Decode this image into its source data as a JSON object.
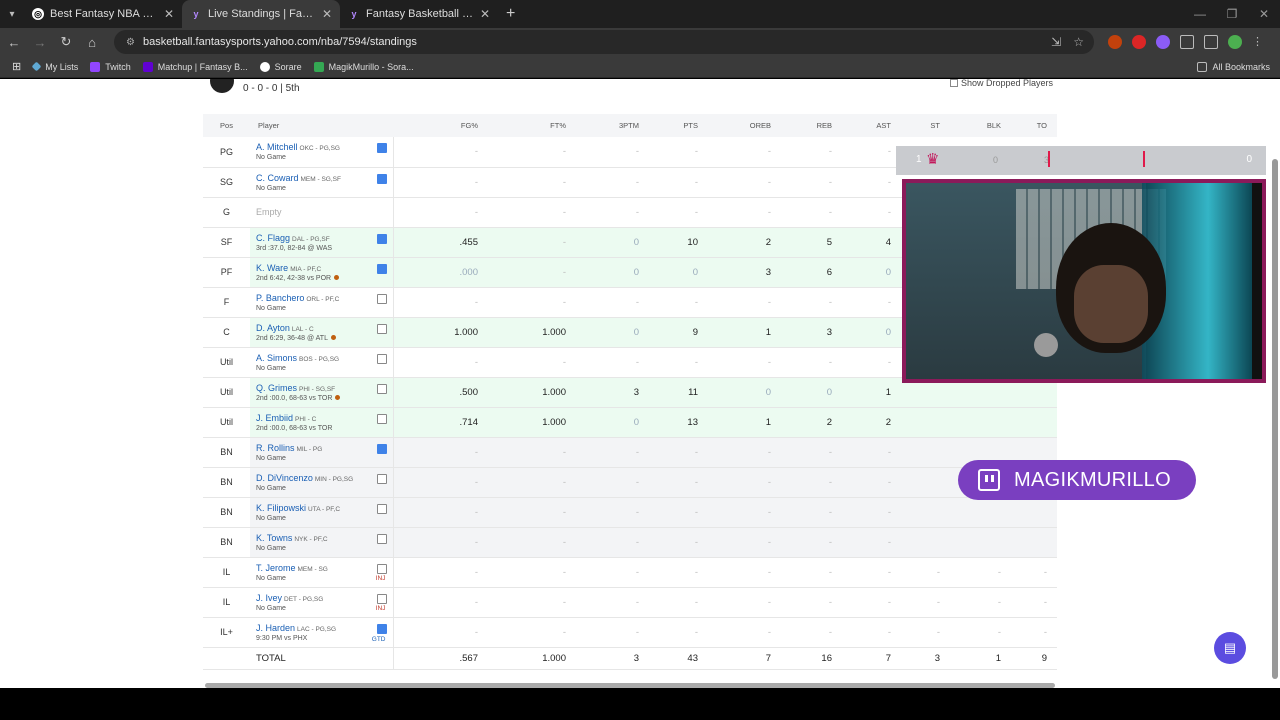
{
  "browser": {
    "tabs": [
      {
        "title": "Best Fantasy NBA – Sorare NBA",
        "active": false
      },
      {
        "title": "Live Standings | Fantasy Basketb",
        "active": true
      },
      {
        "title": "Fantasy Basketball | Yahoo! Spo",
        "active": false
      }
    ],
    "url": "basketball.fantasysports.yahoo.com/nba/7594/standings",
    "bookmarks": [
      "My Lists",
      "Twitch",
      "Matchup | Fantasy B...",
      "Sorare",
      "MagikMurillo - Sora..."
    ],
    "all_bookmarks": "All Bookmarks"
  },
  "team": {
    "record": "0 - 0 - 0 | 5th"
  },
  "show_dropped_label": "Show Dropped Players",
  "columns": [
    "Pos",
    "Player",
    "FG%",
    "FT%",
    "3PTM",
    "PTS",
    "OREB",
    "REB",
    "AST",
    "ST",
    "BLK",
    "TO"
  ],
  "rows": [
    {
      "pos": "PG",
      "name": "A. Mitchell",
      "team": "OKC - PG,SG",
      "status": "No Game",
      "note": "blue",
      "tag": "",
      "type": "normal",
      "stats": [
        "-",
        "-",
        "-",
        "-",
        "-",
        "-",
        "-",
        "-",
        "-",
        "-"
      ]
    },
    {
      "pos": "SG",
      "name": "C. Coward",
      "team": "MEM - SG,SF",
      "status": "No Game",
      "note": "blue",
      "tag": "",
      "type": "normal",
      "stats": [
        "-",
        "-",
        "-",
        "-",
        "-",
        "-",
        "-",
        "-",
        "-",
        "-"
      ]
    },
    {
      "pos": "G",
      "name": "Empty",
      "team": "",
      "status": "",
      "note": "",
      "tag": "",
      "type": "empty",
      "stats": [
        "-",
        "-",
        "-",
        "-",
        "-",
        "-",
        "-",
        "-",
        "-",
        "-"
      ]
    },
    {
      "pos": "SF",
      "name": "C. Flagg",
      "team": "DAL - PG,SF",
      "status": "3rd :37.0, 82-84 @ WAS",
      "note": "blue",
      "tag": "",
      "type": "played",
      "stats": [
        ".455",
        "-",
        "0",
        "10",
        "2",
        "5",
        "4",
        "",
        "",
        ""
      ]
    },
    {
      "pos": "PF",
      "name": "K. Ware",
      "team": "MIA - PF,C",
      "status": "2nd 6:42, 42-38 vs POR",
      "note": "blue",
      "tag": "dot",
      "type": "played",
      "stats": [
        ".000",
        "-",
        "0",
        "0",
        "3",
        "6",
        "0",
        "",
        "",
        ""
      ]
    },
    {
      "pos": "F",
      "name": "P. Banchero",
      "team": "ORL - PF,C",
      "status": "No Game",
      "note": "grey",
      "tag": "",
      "type": "normal",
      "stats": [
        "-",
        "-",
        "-",
        "-",
        "-",
        "-",
        "-",
        "",
        "",
        ""
      ]
    },
    {
      "pos": "C",
      "name": "D. Ayton",
      "team": "LAL - C",
      "status": "2nd 6:29, 36-48 @ ATL",
      "note": "grey",
      "tag": "dot",
      "type": "played",
      "stats": [
        "1.000",
        "1.000",
        "0",
        "9",
        "1",
        "3",
        "0",
        "",
        "",
        ""
      ]
    },
    {
      "pos": "Util",
      "name": "A. Simons",
      "team": "BOS - PG,SG",
      "status": "No Game",
      "note": "grey",
      "tag": "",
      "type": "normal",
      "stats": [
        "-",
        "-",
        "-",
        "-",
        "-",
        "-",
        "-",
        "",
        "",
        ""
      ]
    },
    {
      "pos": "Util",
      "name": "Q. Grimes",
      "team": "PHI - SG,SF",
      "status": "2nd :00.0, 68-63 vs TOR",
      "note": "grey",
      "tag": "dot",
      "type": "played",
      "stats": [
        ".500",
        "1.000",
        "3",
        "11",
        "0",
        "0",
        "1",
        "",
        "",
        ""
      ]
    },
    {
      "pos": "Util",
      "name": "J. Embiid",
      "team": "PHI - C",
      "status": "2nd :00.0, 68-63 vs TOR",
      "note": "grey",
      "tag": "",
      "type": "played",
      "stats": [
        ".714",
        "1.000",
        "0",
        "13",
        "1",
        "2",
        "2",
        "",
        "",
        ""
      ]
    },
    {
      "pos": "BN",
      "name": "R. Rollins",
      "team": "MIL - PG",
      "status": "No Game",
      "note": "blue",
      "tag": "",
      "type": "bench",
      "stats": [
        "-",
        "-",
        "-",
        "-",
        "-",
        "-",
        "-",
        "",
        "",
        ""
      ]
    },
    {
      "pos": "BN",
      "name": "D. DiVincenzo",
      "team": "MIN - PG,SG",
      "status": "No Game",
      "note": "grey",
      "tag": "",
      "type": "bench",
      "stats": [
        "-",
        "-",
        "-",
        "-",
        "-",
        "-",
        "-",
        "",
        "",
        ""
      ]
    },
    {
      "pos": "BN",
      "name": "K. Filipowski",
      "team": "UTA - PF,C",
      "status": "No Game",
      "note": "grey",
      "tag": "",
      "type": "bench",
      "stats": [
        "-",
        "-",
        "-",
        "-",
        "-",
        "-",
        "-",
        "",
        "",
        ""
      ]
    },
    {
      "pos": "BN",
      "name": "K. Towns",
      "team": "NYK - PF,C",
      "status": "No Game",
      "note": "grey",
      "tag": "",
      "type": "bench",
      "stats": [
        "-",
        "-",
        "-",
        "-",
        "-",
        "-",
        "-",
        "",
        "",
        ""
      ]
    },
    {
      "pos": "IL",
      "name": "T. Jerome",
      "team": "MEM - SG",
      "status": "No Game",
      "note": "grey",
      "tag": "INJ",
      "type": "normal",
      "stats": [
        "-",
        "-",
        "-",
        "-",
        "-",
        "-",
        "-",
        "-",
        "-",
        "-"
      ]
    },
    {
      "pos": "IL",
      "name": "J. Ivey",
      "team": "DET - PG,SG",
      "status": "No Game",
      "note": "grey",
      "tag": "INJ",
      "type": "normal",
      "stats": [
        "-",
        "-",
        "-",
        "-",
        "-",
        "-",
        "-",
        "-",
        "-",
        "-"
      ]
    },
    {
      "pos": "IL+",
      "name": "J. Harden",
      "team": "LAC - PG,SG",
      "status": "9:30 PM vs PHX",
      "note": "blue",
      "tag": "GTD",
      "type": "normal",
      "stats": [
        "-",
        "-",
        "-",
        "-",
        "-",
        "-",
        "-",
        "-",
        "-",
        "-"
      ]
    }
  ],
  "total": {
    "label": "TOTAL",
    "stats": [
      ".567",
      "1.000",
      "3",
      "43",
      "7",
      "16",
      "7",
      "3",
      "1",
      "9"
    ]
  },
  "overlay": {
    "left_num": "1",
    "mid_a": "0",
    "mid_b": "3",
    "right_num": "0"
  },
  "streamer": {
    "name": "MAGIKMURILLO"
  },
  "colors": {
    "yahoo_purple": "#5b4ce0",
    "twitch_purple": "#7a3fc0",
    "played_row": "#ecfbf1",
    "link_blue": "#1a5fb4"
  }
}
